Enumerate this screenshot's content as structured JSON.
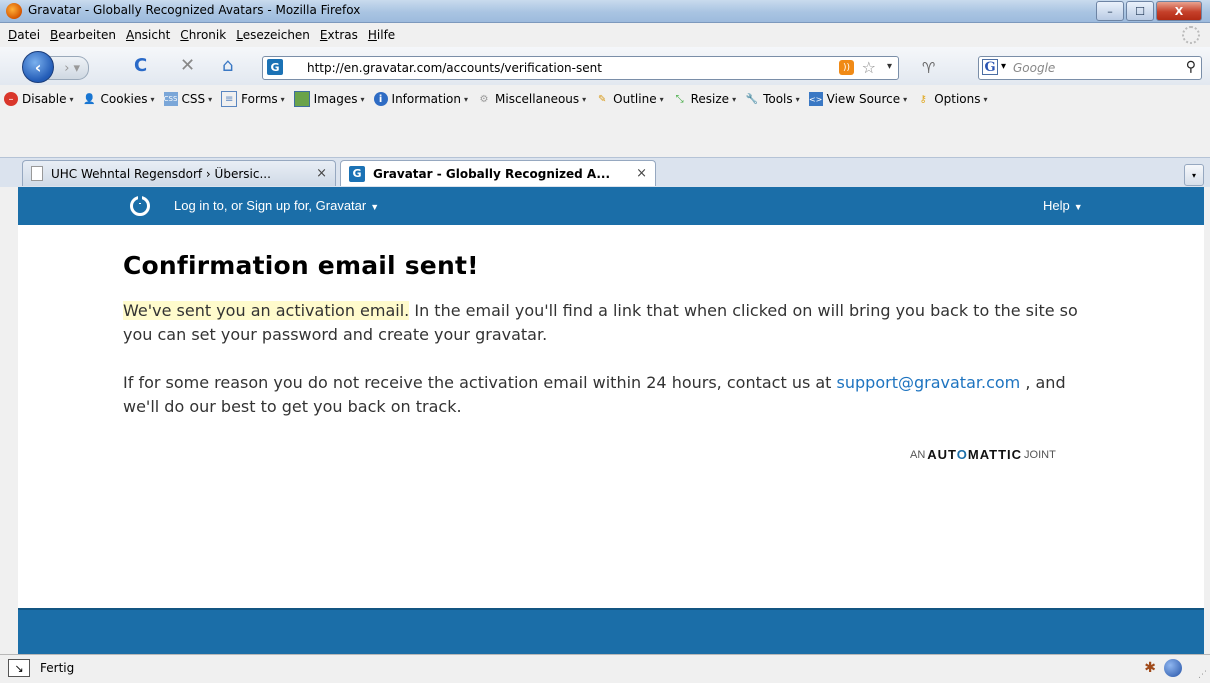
{
  "window": {
    "title": "Gravatar - Globally Recognized Avatars - Mozilla Firefox",
    "buttons": {
      "minimize": "–",
      "maximize": "☐",
      "close": "X"
    }
  },
  "menubar": {
    "items": [
      "Datei",
      "Bearbeiten",
      "Ansicht",
      "Chronik",
      "Lesezeichen",
      "Extras",
      "Hilfe"
    ]
  },
  "navbar": {
    "url": "http://en.gravatar.com/accounts/verification-sent",
    "search_placeholder": "Google"
  },
  "devtoolbar": {
    "items": [
      "Disable",
      "Cookies",
      "CSS",
      "Forms",
      "Images",
      "Information",
      "Miscellaneous",
      "Outline",
      "Resize",
      "Tools",
      "View Source",
      "Options"
    ]
  },
  "tabs": [
    {
      "label": "UHC Wehntal Regensdorf › Übersic...",
      "close": "×"
    },
    {
      "label": "Gravatar - Globally Recognized A...",
      "close": "×"
    }
  ],
  "site": {
    "nav_login": "Log in to, or Sign up for, Gravatar",
    "nav_help": "Help",
    "heading": "Confirmation email sent!",
    "para1_highlight": "We've sent you an activation email.",
    "para1_rest": " In the email you'll find a link that when clicked on will bring you back to the site so you can set your password and create your gravatar.",
    "para2_start": "If for some reason you do not receive the activation email within 24 hours, contact us at ",
    "support_email": "support@gravatar.com",
    "para2_end": " , and we'll do our best to get you back on track.",
    "automattic": {
      "pre": "AN",
      "brand_a": "AUT",
      "brand_o": "O",
      "brand_b": "MATTIC",
      "post": "JOINT"
    }
  },
  "status": {
    "text": "Fertig"
  },
  "colors": {
    "gravatar_blue": "#1b6ea8",
    "link": "#1e74c0",
    "highlight": "#fffbcc"
  }
}
